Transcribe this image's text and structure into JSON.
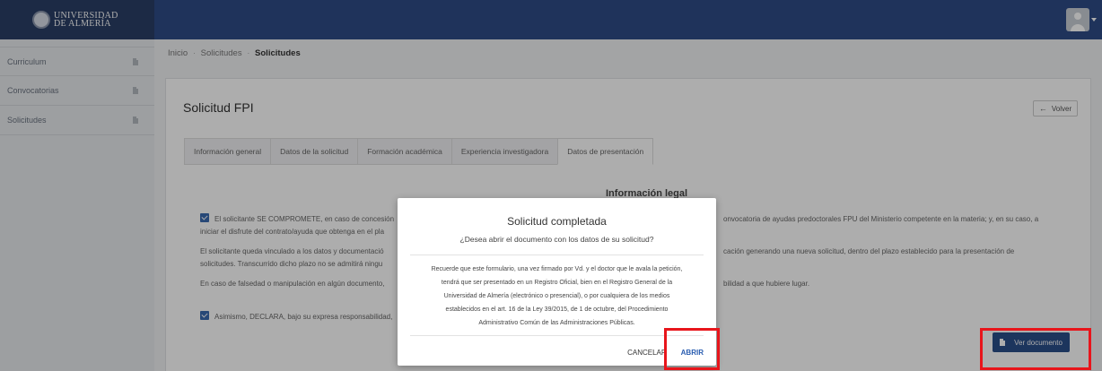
{
  "header": {
    "logo_text_line1": "UNIVERSIDAD",
    "logo_text_line2": "DE ALMERÍA"
  },
  "sidebar": {
    "items": [
      {
        "label": "Curriculum"
      },
      {
        "label": "Convocatorias"
      },
      {
        "label": "Solicitudes"
      }
    ]
  },
  "breadcrumb": {
    "items": [
      "Inicio",
      "Solicitudes"
    ],
    "current": "Solicitudes",
    "separator": "·"
  },
  "page": {
    "title": "Solicitud FPI",
    "back_label": "Volver",
    "tabs": [
      {
        "label": "Información general"
      },
      {
        "label": "Datos de la solicitud"
      },
      {
        "label": "Formación académica"
      },
      {
        "label": "Experiencia investigadora"
      },
      {
        "label": "Datos de presentación",
        "active": true
      }
    ],
    "section_title": "Información legal",
    "paragraphs": {
      "p1_left_line1": "El solicitante SE COMPROMETE, en caso de concesión",
      "p1_left_line2": "iniciar el disfrute del contrato/ayuda que obtenga en el pla",
      "p1_right": "onvocatoria de ayudas predoctorales FPU del Ministerio competente en la materia; y, en su caso, a",
      "p2_left_line1": "El solicitante queda vinculado a los datos y documentació",
      "p2_left_line2": "solicitudes. Transcurrido dicho plazo no se admitirá ningu",
      "p2_right": "cación generando una nueva solicitud, dentro del plazo establecido para la presentación de",
      "p3_left": "En caso de falsedad o manipulación en algún documento,",
      "p3_right": "bilidad a que hubiere lugar.",
      "p4_left": "Asimismo, DECLARA, bajo su expresa responsabilidad,"
    },
    "ver_documento_label": "Ver documento"
  },
  "modal": {
    "title": "Solicitud completada",
    "subtitle": "¿Desea abrir el documento con los datos de su solicitud?",
    "body_lines": [
      "Recuerde que este formulario, una vez firmado por Vd. y el doctor que le avala la petición,",
      "tendrá que ser presentado en un Registro Oficial, bien en el Registro General de la",
      "Universidad de Almería (electrónico o presencial), o por cualquiera de los medios",
      "establecidos en el art. 16 de la Ley 39/2015, de 1 de octubre, del Procedimiento",
      "Administrativo Común de las Administraciones Públicas."
    ],
    "cancel_label": "CANCELAR",
    "open_label": "ABRIR"
  },
  "colors": {
    "topbar": "#2e4c86",
    "primary_button": "#2a4e8a",
    "highlight": "#e8151b",
    "link": "#2a5db0"
  }
}
